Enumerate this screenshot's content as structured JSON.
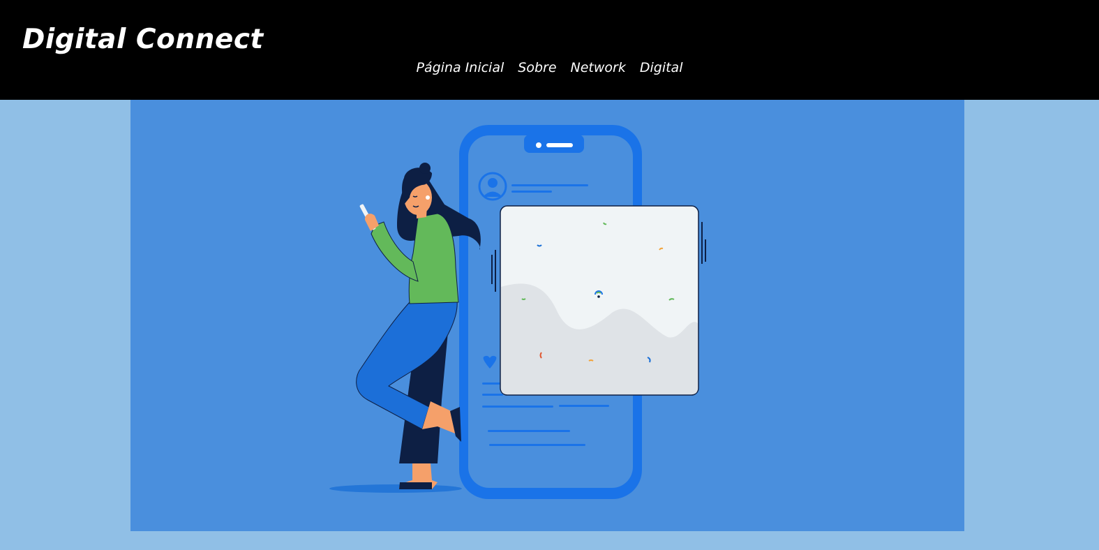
{
  "header": {
    "brand": "Digital Connect",
    "nav": [
      {
        "label": "Página Inicial"
      },
      {
        "label": "Sobre"
      },
      {
        "label": "Network"
      },
      {
        "label": "Digital"
      }
    ]
  },
  "colors": {
    "header_bg": "#000000",
    "page_bg": "#90bfe6",
    "hero_bg": "#4a8fdd",
    "phone": "#1a73e8",
    "shirt": "#63b95a",
    "pants": "#1c6fd8",
    "dark_navy": "#0d1f44",
    "skin": "#f5a06a",
    "card": "#f0f4f6"
  },
  "hero": {
    "illustration": "woman-leaning-on-smartphone-illustration"
  }
}
